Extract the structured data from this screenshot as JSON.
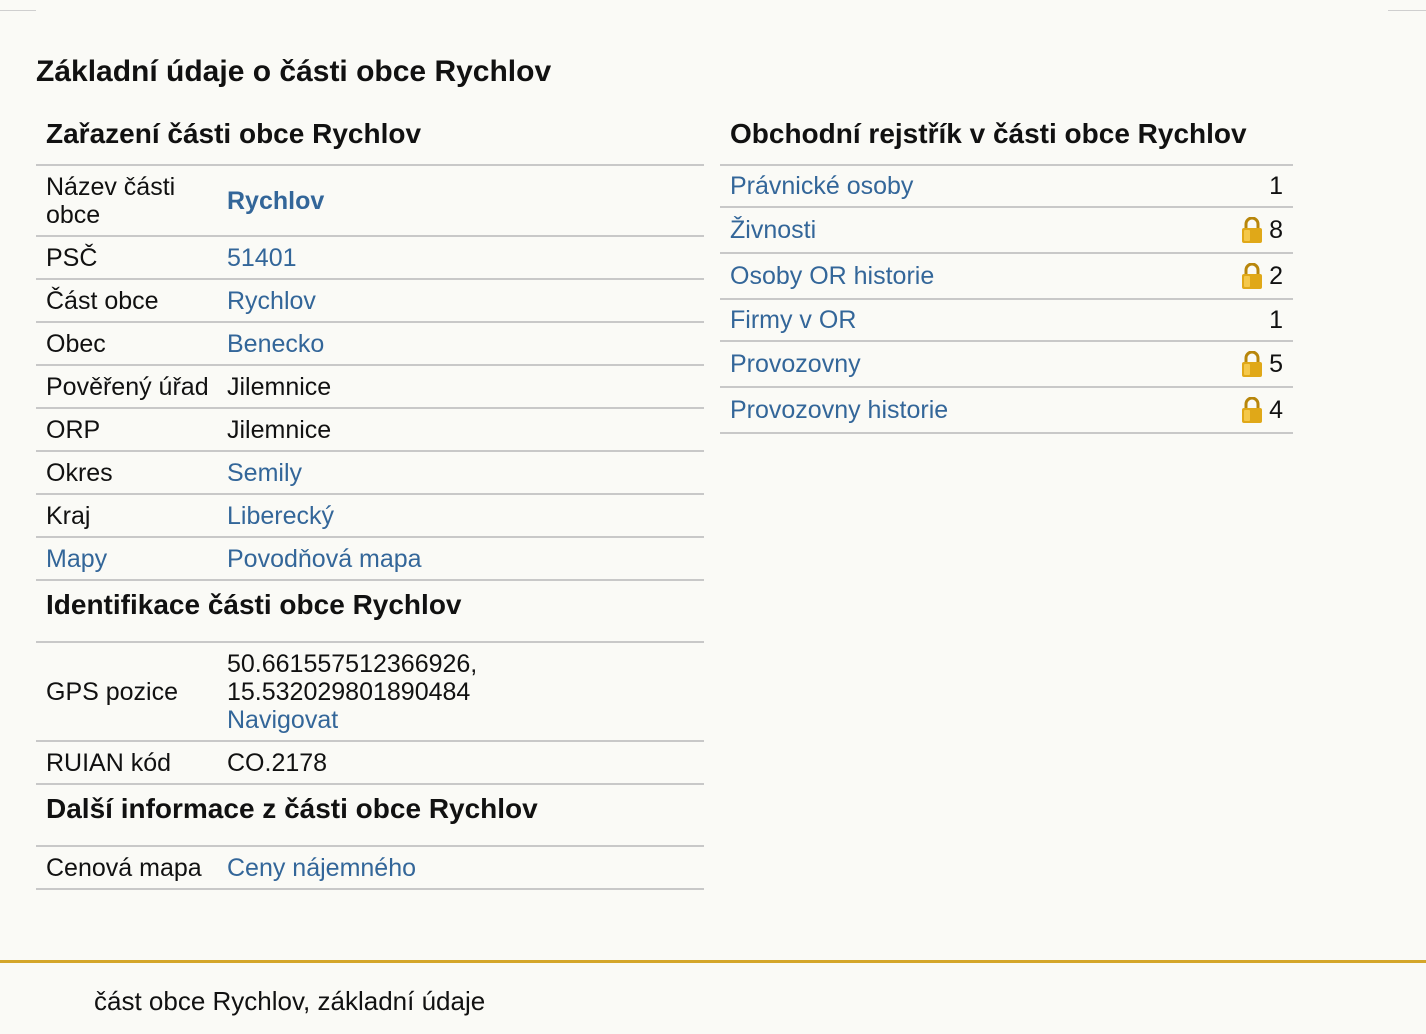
{
  "page_title": "Základní údaje o části obce Rychlov",
  "classification": {
    "heading": "Zařazení části obce Rychlov",
    "rows": [
      {
        "label": "Název části obce",
        "value": "Rychlov"
      },
      {
        "label": "PSČ",
        "value": "51401"
      },
      {
        "label": "Část obce",
        "value": "Rychlov"
      },
      {
        "label": "Obec",
        "value": "Benecko"
      },
      {
        "label": "Pověřený úřad",
        "value": "Jilemnice"
      },
      {
        "label": "ORP",
        "value": "Jilemnice"
      },
      {
        "label": "Okres",
        "value": "Semily"
      },
      {
        "label": "Kraj",
        "value": "Liberecký"
      },
      {
        "label": "Mapy",
        "value": "Povodňová mapa"
      }
    ]
  },
  "identification": {
    "heading": "Identifikace části obce Rychlov",
    "gps_label": "GPS pozice",
    "gps_lat": "50.661557512366926,",
    "gps_lon": "15.532029801890484",
    "navigate_label": "Navigovat",
    "ruian_label": "RUIAN kód",
    "ruian_value": "CO.2178"
  },
  "more_info": {
    "heading": "Další informace z části obce Rychlov",
    "price_map_label": "Cenová mapa",
    "price_map_value": "Ceny nájemného"
  },
  "business_register": {
    "heading": "Obchodní rejstřík v části obce Rychlov",
    "rows": [
      {
        "label": "Právnické osoby",
        "count": "1",
        "locked": false
      },
      {
        "label": "Živnosti",
        "count": "8",
        "locked": true
      },
      {
        "label": "Osoby OR historie",
        "count": "2",
        "locked": true
      },
      {
        "label": "Firmy v OR",
        "count": "1",
        "locked": false
      },
      {
        "label": "Provozovny",
        "count": "5",
        "locked": true
      },
      {
        "label": "Provozovny historie",
        "count": "4",
        "locked": true
      }
    ]
  },
  "footer": {
    "text": "část obce Rychlov, základní údaje"
  },
  "colors": {
    "link": "#336699",
    "footer_accent": "#d4a62a",
    "row_border": "#c8c8c8",
    "background": "#fafaf6",
    "lock_gold": "#e0a818"
  },
  "icons": {
    "lock": "lock-icon"
  }
}
